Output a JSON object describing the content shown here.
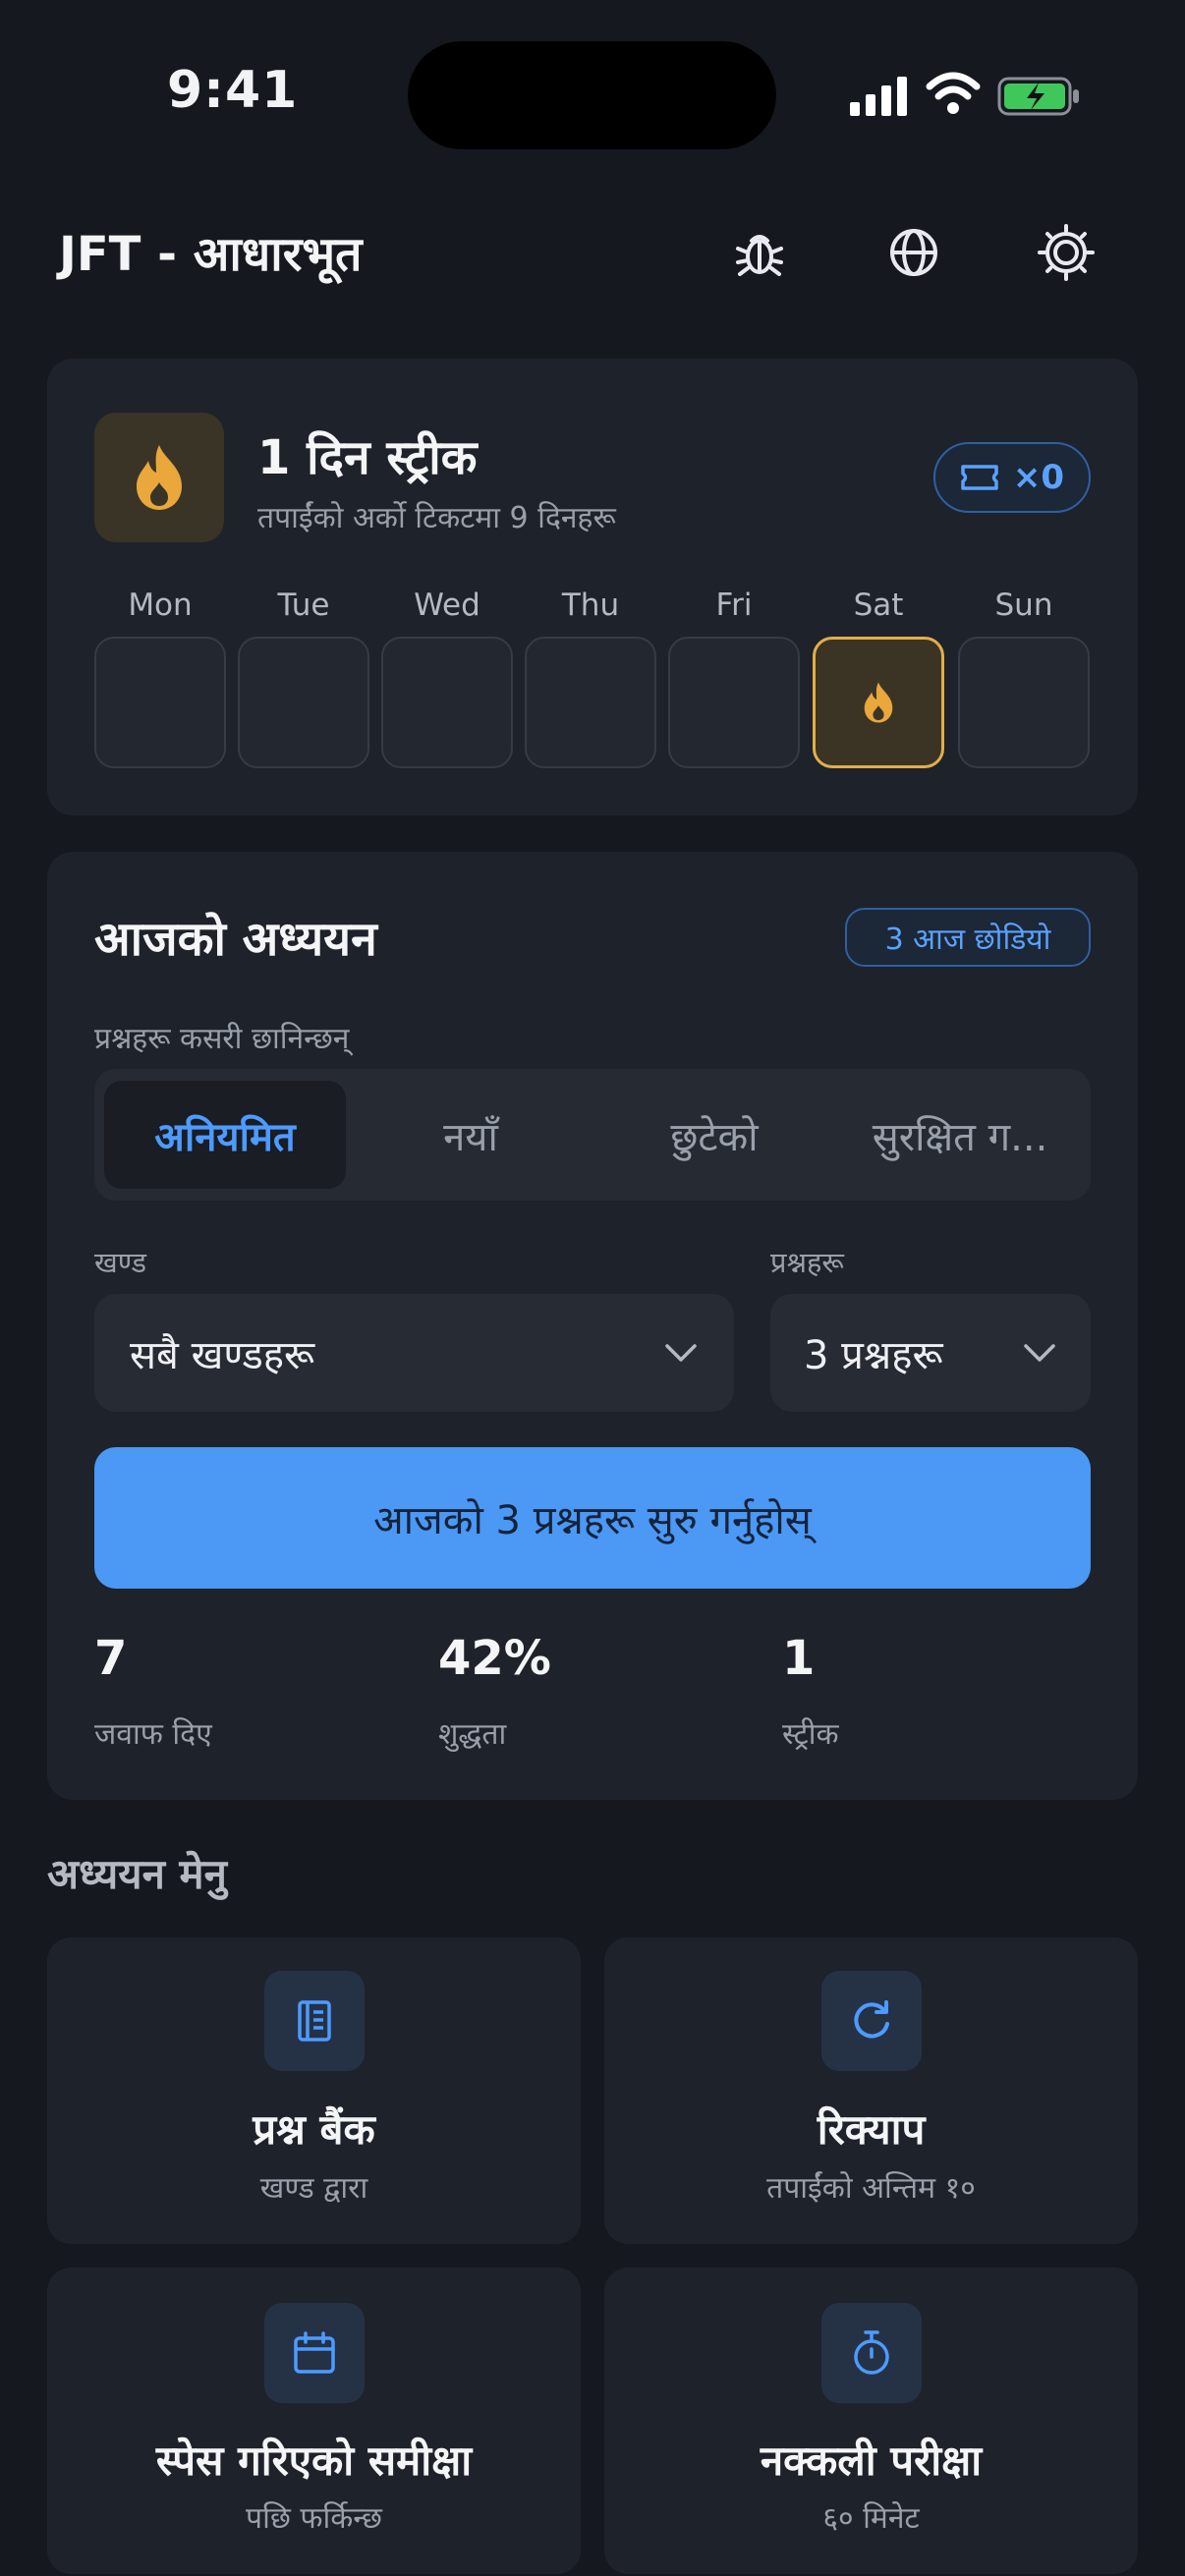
{
  "status_bar": {
    "time": "9:41"
  },
  "header": {
    "title": "JFT - आधारभूत",
    "icons": [
      "bug-icon",
      "globe-icon",
      "sun-icon"
    ]
  },
  "streak": {
    "title": "1 दिन स्ट्रीक",
    "subtitle": "तपाईंको अर्को टिकटमा 9 दिनहरू",
    "ticket_count": "×0",
    "days": [
      "Mon",
      "Tue",
      "Wed",
      "Thu",
      "Fri",
      "Sat",
      "Sun"
    ],
    "active_day": "Sat",
    "accent": "#e2ae4c"
  },
  "study": {
    "title": "आजको अध्ययन",
    "skip_badge": "3 आज छोडियो",
    "filter_label": "प्रश्नहरू कसरी छानिन्छन्",
    "segments": [
      "अनियमित",
      "नयाँ",
      "छुटेको",
      "सुरक्षित ग..."
    ],
    "active_segment": "अनियमित",
    "section_label": "खण्ड",
    "section_value": "सबै खण्डहरू",
    "questions_label": "प्रश्नहरू",
    "questions_value": "3 प्रश्नहरू",
    "start_button": "आजको 3 प्रश्नहरू सुरु गर्नुहोस्",
    "stats": [
      {
        "value": "7",
        "label": "जवाफ दिए"
      },
      {
        "value": "42%",
        "label": "शुद्धता"
      },
      {
        "value": "1",
        "label": "स्ट्रीक"
      }
    ],
    "accent": "#4b98f5"
  },
  "menu": {
    "heading": "अध्ययन मेनु",
    "items": [
      {
        "title": "प्रश्न बैंक",
        "subtitle": "खण्ड द्वारा",
        "icon": "book-icon"
      },
      {
        "title": "रिक्याप",
        "subtitle": "तपाईंको अन्तिम १०",
        "icon": "refresh-icon"
      },
      {
        "title": "स्पेस गरिएको समीक्षा",
        "subtitle": "पछि फर्किन्छ",
        "icon": "calendar-icon"
      },
      {
        "title": "नक्कली परीक्षा",
        "subtitle": "६० मिनेट",
        "icon": "stopwatch-icon"
      }
    ]
  }
}
